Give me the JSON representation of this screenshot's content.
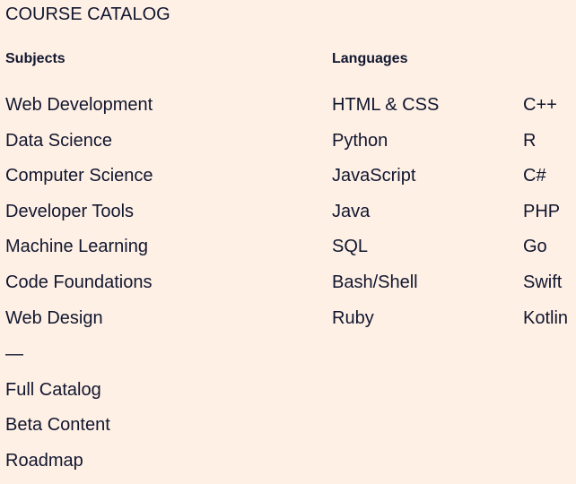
{
  "title": "COURSE CATALOG",
  "subjects": {
    "heading": "Subjects",
    "items": [
      "Web Development",
      "Data Science",
      "Computer Science",
      "Developer Tools",
      "Machine Learning",
      "Code Foundations",
      "Web Design"
    ]
  },
  "languages": {
    "heading": "Languages",
    "col1": [
      "HTML & CSS",
      "Python",
      "JavaScript",
      "Java",
      "SQL",
      "Bash/Shell",
      "Ruby"
    ],
    "col2": [
      "C++",
      "R",
      "C#",
      "PHP",
      "Go",
      "Swift",
      "Kotlin"
    ]
  },
  "separator": "—",
  "extra_links": [
    "Full Catalog",
    "Beta Content",
    "Roadmap"
  ],
  "colors": {
    "background": "#fff0e5",
    "text": "#10162f"
  }
}
